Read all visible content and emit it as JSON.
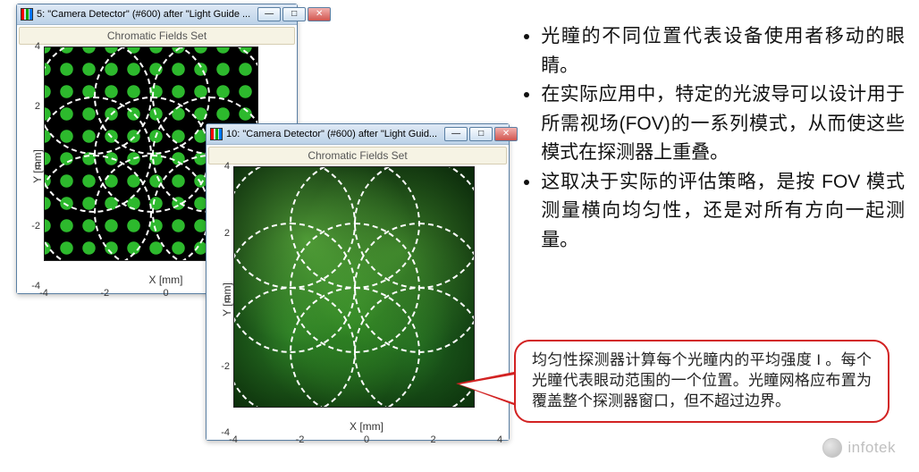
{
  "window1": {
    "title": "5: \"Camera Detector\" (#600) after \"Light Guide ...",
    "subheader": "Chromatic Fields Set"
  },
  "window2": {
    "title": "10: \"Camera Detector\" (#600) after \"Light Guid...",
    "subheader": "Chromatic Fields Set"
  },
  "axes": {
    "xlabel": "X [mm]",
    "ylabel": "Y [mm]",
    "ticks": {
      "neg4": "-4",
      "neg2": "-2",
      "zero": "0",
      "pos2": "2",
      "pos4": "4"
    }
  },
  "win_buttons": {
    "min": "—",
    "max": "□",
    "close": "✕"
  },
  "bullets": {
    "b1": "光瞳的不同位置代表设备使用者移动的眼睛。",
    "b2": "在实际应用中，特定的光波导可以设计用于所需视场(FOV)的一系列模式，从而使这些模式在探测器上重叠。",
    "b3": "这取决于实际的评估策略，是按 FOV 模式测量横向均匀性，还是对所有方向一起测量。"
  },
  "callout": {
    "text": "均匀性探测器计算每个光瞳内的平均强度 I 。每个光瞳代表眼动范围的一个位置。光瞳网格应布置为覆盖整个探测器窗口，但不超过边界。"
  },
  "watermark": "infotek"
}
